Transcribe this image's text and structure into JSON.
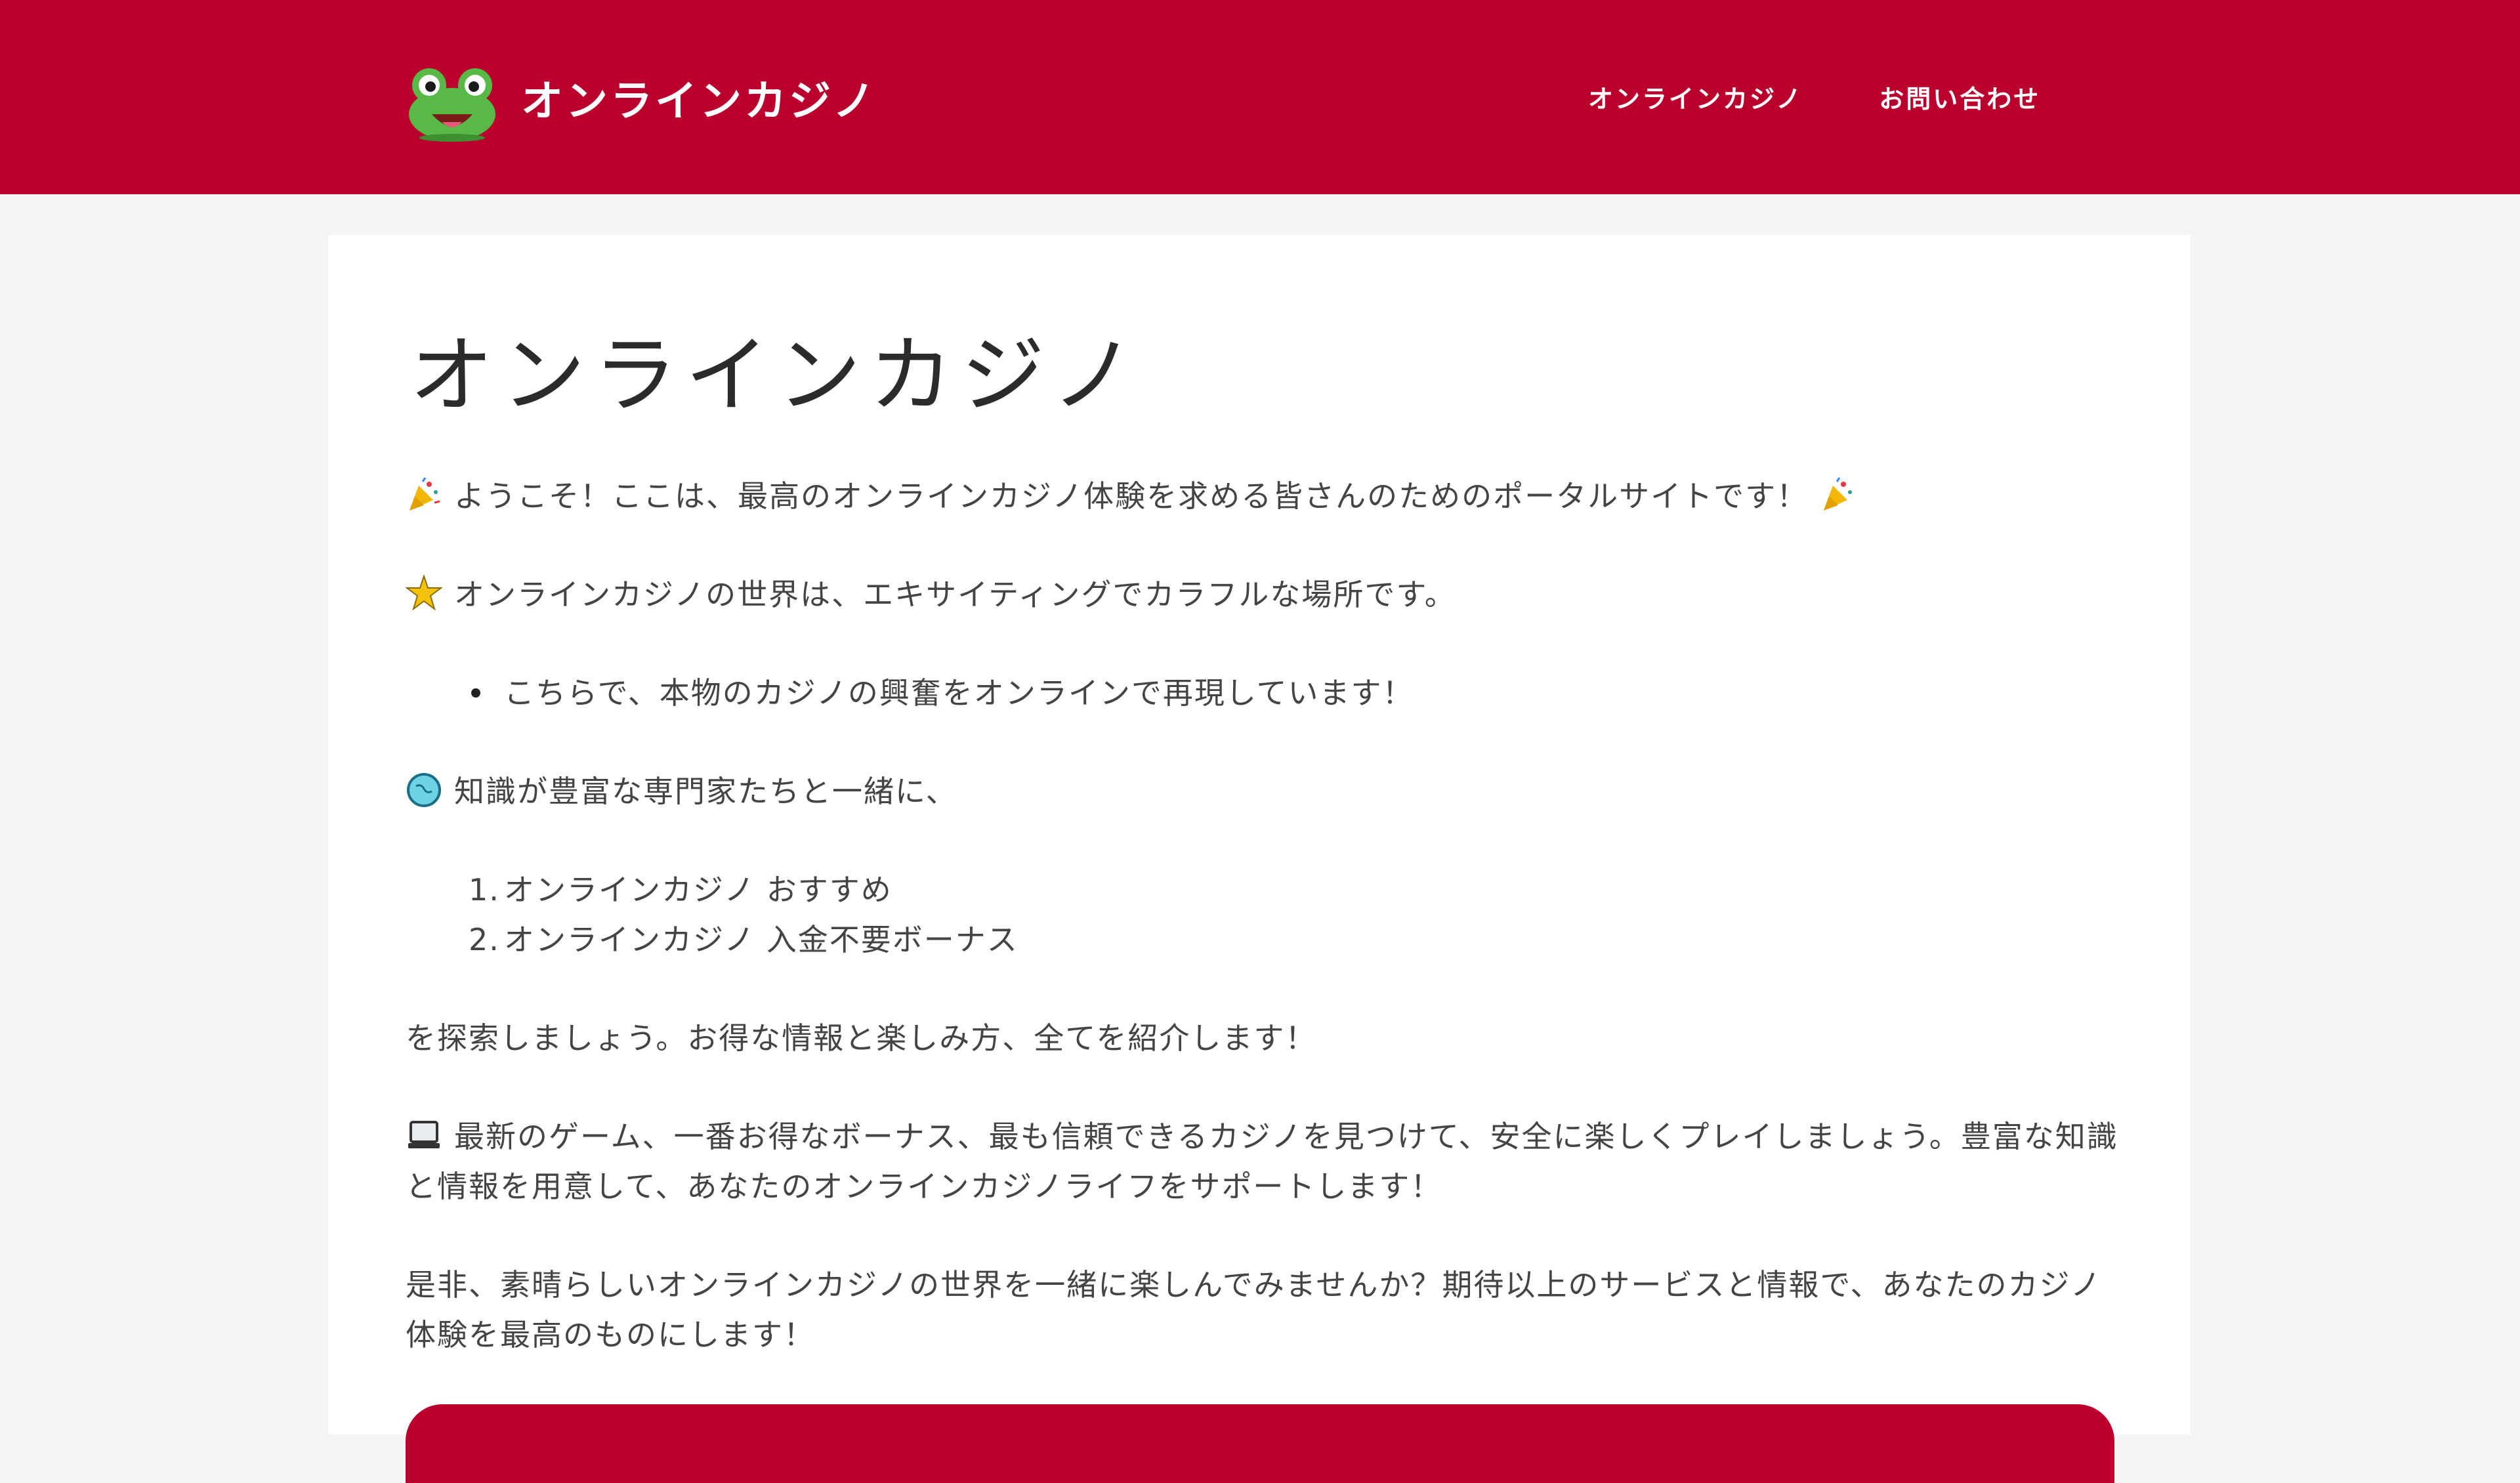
{
  "header": {
    "brand_name": "オンラインカジノ",
    "nav": [
      "オンラインカジノ",
      "お問い合わせ"
    ]
  },
  "main": {
    "title": "オンラインカジノ",
    "paragraphs": {
      "welcome": "ようこそ！ここは、最高のオンラインカジノ体験を求める皆さんのためのポータルサイトです！",
      "world": "オンラインカジノの世界は、エキサイティングでカラフルな場所です。",
      "bullet": "こちらで、本物のカジノの興奮をオンラインで再現しています！",
      "experts": "知識が豊富な専門家たちと一緒に、",
      "list": [
        {
          "num": "1.",
          "text": "オンラインカジノ おすすめ"
        },
        {
          "num": "2.",
          "text": "オンラインカジノ 入金不要ボーナス"
        }
      ],
      "explore": "を探索しましょう。お得な情報と楽しみ方、全てを紹介します！",
      "latest": "最新のゲーム、一番お得なボーナス、最も信頼できるカジノを見つけて、安全に楽しくプレイしましょう。豊富な知識と情報を用意して、あなたのオンラインカジノライフをサポートします！",
      "invite": "是非、素晴らしいオンラインカジノの世界を一緒に楽しんでみませんか？期待以上のサービスと情報で、あなたのカジノ体験を最高のものにします！"
    }
  },
  "colors": {
    "accent": "#ba002d",
    "background": "#f3f4f6",
    "card": "#ffffff",
    "text": "#444444"
  },
  "icons": [
    "frog-logo-icon",
    "party-popper-icon",
    "sparkle-star-icon",
    "globe-icon",
    "laptop-icon"
  ]
}
